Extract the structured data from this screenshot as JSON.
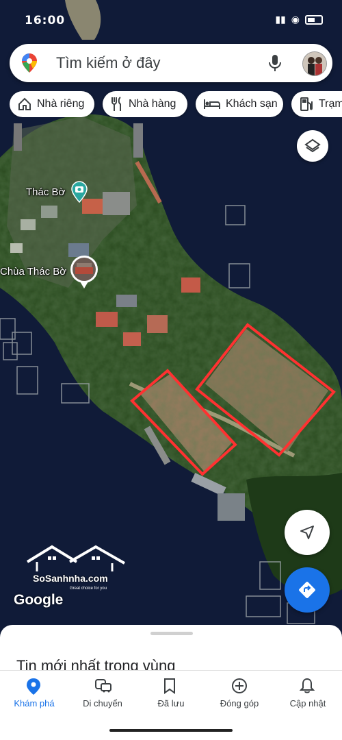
{
  "status_bar": {
    "time": "16:00"
  },
  "search": {
    "placeholder": "Tìm kiếm ở đây"
  },
  "chips": [
    {
      "label": "Nhà riêng",
      "icon": "home-icon"
    },
    {
      "label": "Nhà hàng",
      "icon": "restaurant-icon"
    },
    {
      "label": "Khách sạn",
      "icon": "hotel-icon"
    },
    {
      "label": "Trạm",
      "icon": "gas-station-icon"
    }
  ],
  "places": [
    {
      "name": "Thác Bờ",
      "icon": "camera-pin-icon"
    },
    {
      "name": "Chùa Thác Bờ",
      "icon": "photo-pin-icon"
    }
  ],
  "map": {
    "water_color": "#0f1a33",
    "marked_parcels": 2,
    "parcel_outline_color": "#ff3131"
  },
  "attribution": "Google",
  "watermark": {
    "name": "SoSanhnha.com",
    "tagline": "Great choice for you"
  },
  "sheet": {
    "title": "Tin mới nhất trong vùng"
  },
  "bottom_nav": [
    {
      "label": "Khám phá",
      "icon": "explore-pin-icon",
      "active": true
    },
    {
      "label": "Di chuyển",
      "icon": "commute-icon",
      "active": false
    },
    {
      "label": "Đã lưu",
      "icon": "bookmark-icon",
      "active": false
    },
    {
      "label": "Đóng góp",
      "icon": "add-circle-icon",
      "active": false
    },
    {
      "label": "Cập nhật",
      "icon": "bell-icon",
      "active": false
    }
  ],
  "colors": {
    "accent": "#1a73e8",
    "pin_teal": "#2aa7a0"
  }
}
